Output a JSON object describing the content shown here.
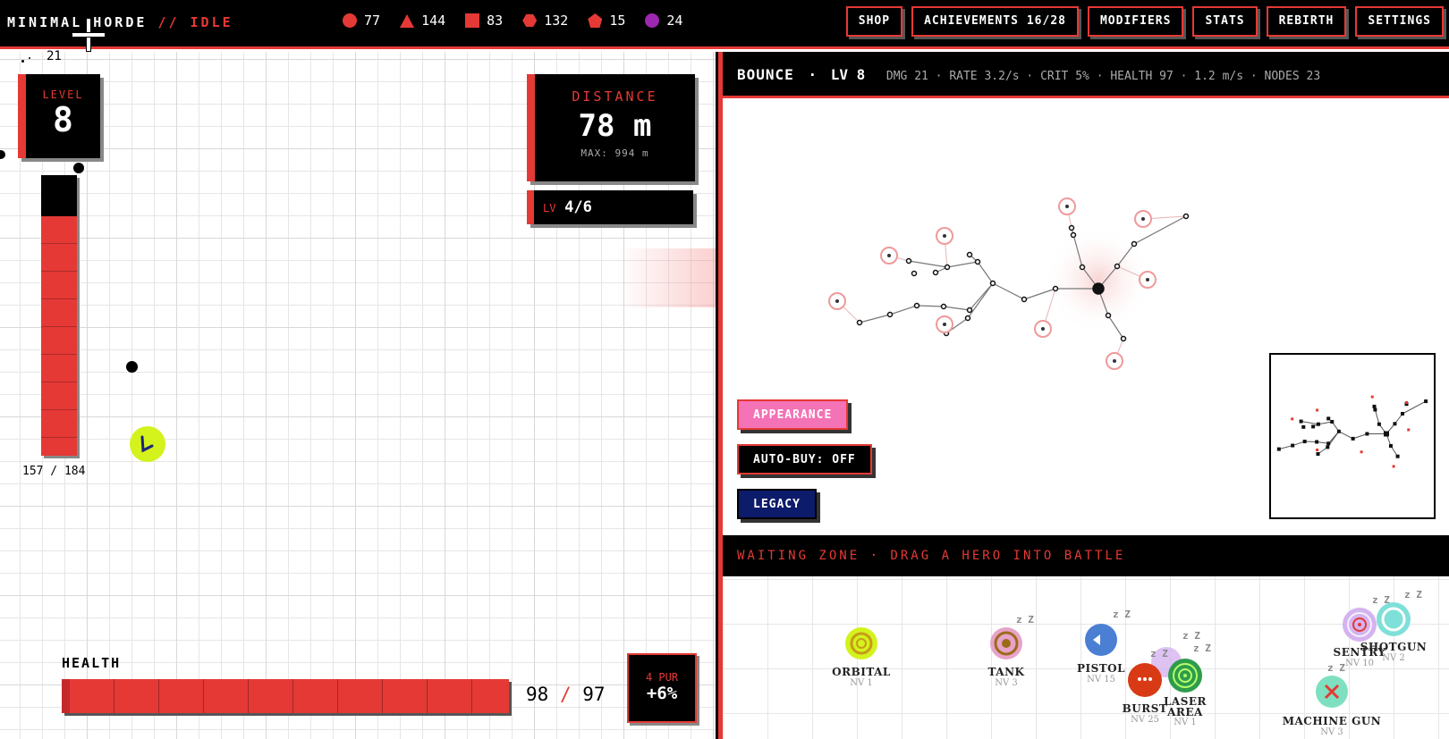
{
  "topbar": {
    "brand_a": "MINIMAL HORDE",
    "brand_sep": "//",
    "brand_state": "IDLE",
    "resources": [
      {
        "icon": "circle-icon",
        "value": "77"
      },
      {
        "icon": "triangle-icon",
        "value": "144"
      },
      {
        "icon": "square-icon",
        "value": "83"
      },
      {
        "icon": "hexagon-icon",
        "value": "132"
      },
      {
        "icon": "pentagon-icon",
        "value": "15"
      },
      {
        "icon": "orb-icon",
        "value": "24"
      }
    ],
    "nav": {
      "shop": "SHOP",
      "achievements": "ACHIEVEMENTS 16/28",
      "modifiers": "MODIFIERS",
      "stats": "STATS",
      "rebirth": "REBIRTH",
      "settings": "SETTINGS"
    }
  },
  "field": {
    "top_count": "21",
    "level_label": "LEVEL",
    "level_value": "8",
    "xp_text": "157 / 184",
    "xp_fraction": 0.853,
    "distance_label": "DISTANCE",
    "distance_value": "78 m",
    "distance_max": "MAX: 994 m",
    "lv_key": "LV",
    "lv_value": "4/6",
    "health_label": "HEALTH",
    "health_current": "98",
    "health_sep": "/",
    "health_max": "97",
    "pur_key": "4 PUR",
    "pur_value": "+6%"
  },
  "skill": {
    "name": "BOUNCE",
    "sep": "·",
    "level": "LV 8",
    "stats": "DMG 21 · RATE 3.2/s · CRIT 5% · HEALTH 97 · 1.2 m/s · NODES 23"
  },
  "buttons": {
    "appearance": "APPEARANCE",
    "autobuy": "AUTO-BUY: OFF",
    "legacy": "LEGACY"
  },
  "waiting": {
    "title": "WAITING ZONE · DRAG A HERO INTO BATTLE",
    "heroes": [
      {
        "name": "ORBITAL",
        "lv": "NV 1"
      },
      {
        "name": "TANK",
        "lv": "NV 3"
      },
      {
        "name": "PISTOL",
        "lv": "NV 15"
      },
      {
        "name": "BURST",
        "lv": "NV 25"
      },
      {
        "name": "LASER AREA",
        "lv": "NV 1"
      },
      {
        "name": "SENTRY",
        "lv": "NV 10"
      },
      {
        "name": "SHOTGUN",
        "lv": "NV 2"
      },
      {
        "name": "MACHINE GUN",
        "lv": "NV 3"
      }
    ]
  },
  "colors": {
    "accent": "#e53935",
    "pink": "#f472b6",
    "navy": "#0d1b6b",
    "lime": "#d4f21c"
  }
}
